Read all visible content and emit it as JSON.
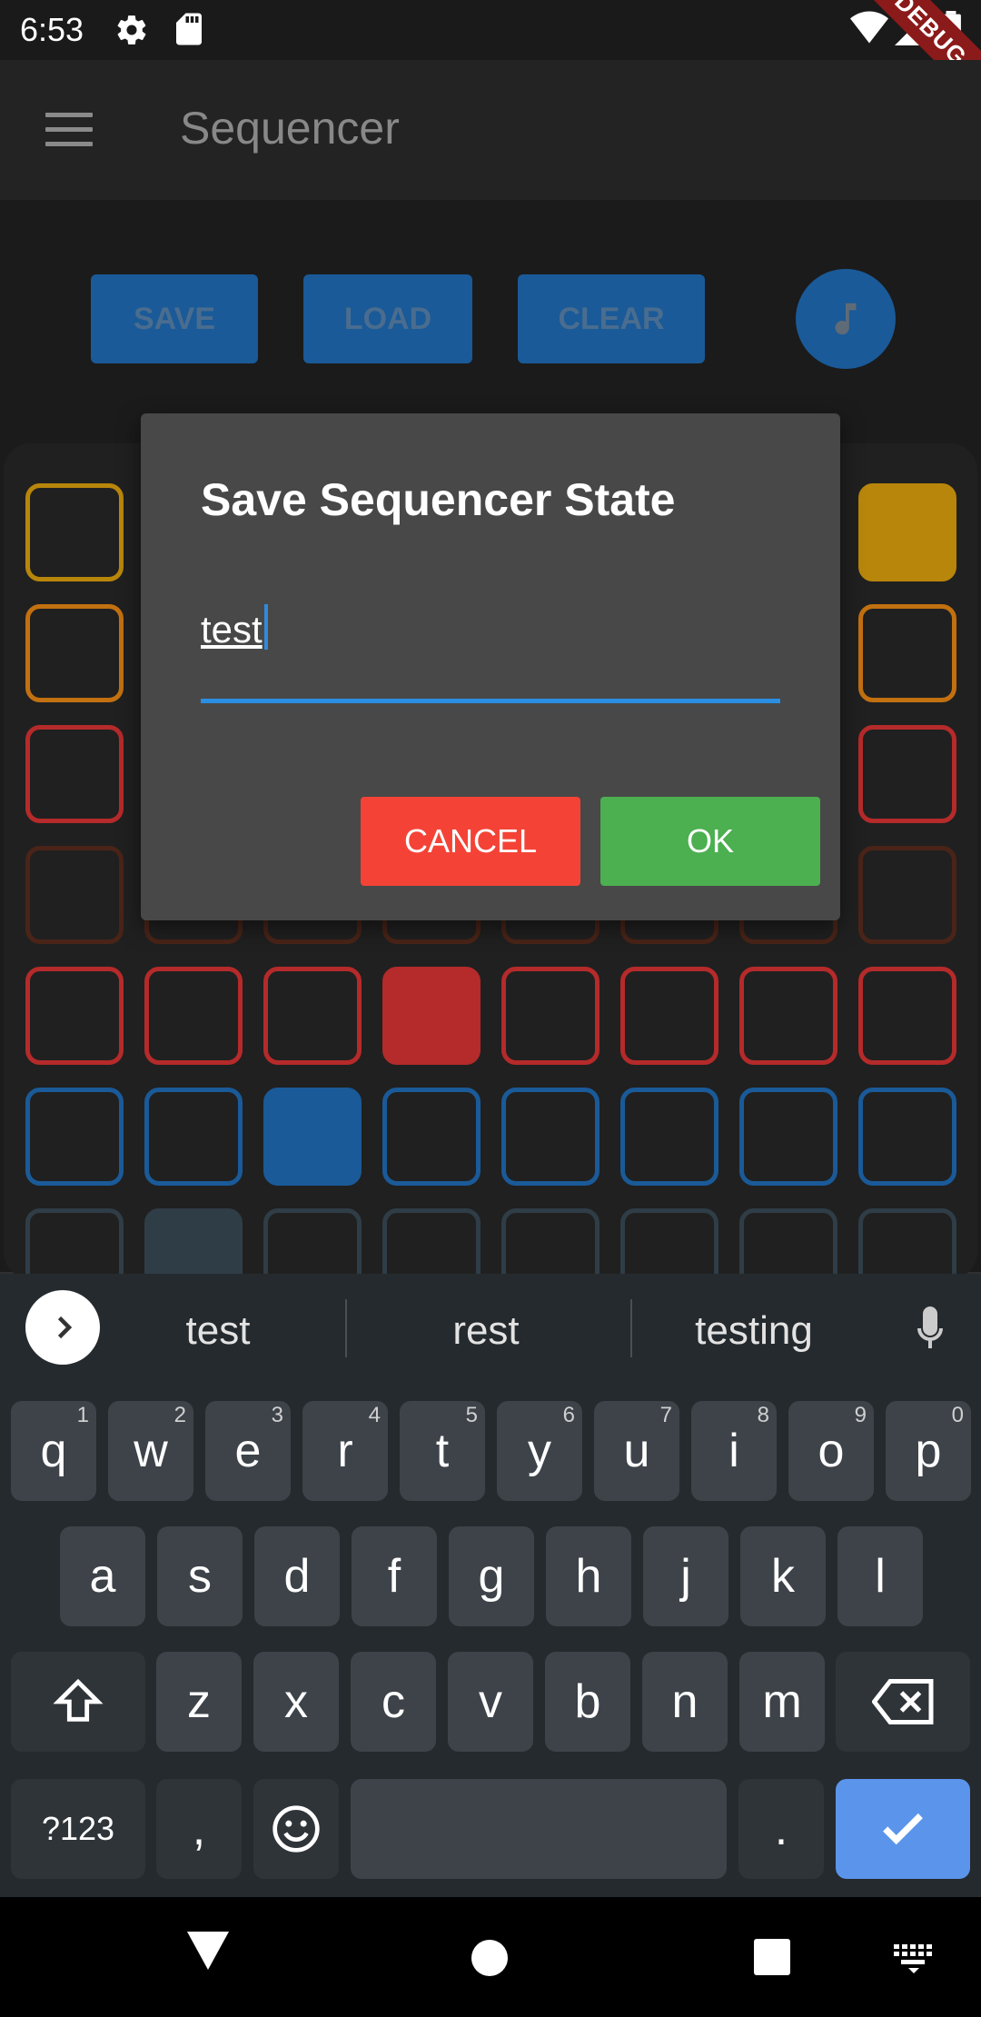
{
  "status_bar": {
    "time": "6:53",
    "debug_label": "DEBUG"
  },
  "app_bar": {
    "title": "Sequencer",
    "menu_icon": "menu-icon"
  },
  "toolbar": {
    "save_label": "SAVE",
    "load_label": "LOAD",
    "clear_label": "CLEAR",
    "fab_icon": "music-note-icon"
  },
  "grid": {
    "row_colors": [
      "#b8860b",
      "#c27010",
      "#b52a2a",
      "#4a2418",
      "#b52a2a",
      "#1a5a98",
      "#2f3d47"
    ],
    "active_cells": [
      [
        0,
        7
      ],
      [
        4,
        3
      ],
      [
        5,
        2
      ],
      [
        6,
        1
      ]
    ]
  },
  "dialog": {
    "title": "Save Sequencer State",
    "input_value": "test",
    "cancel_label": "CANCEL",
    "ok_label": "OK"
  },
  "keyboard": {
    "suggestions": [
      "test",
      "rest",
      "testing"
    ],
    "row1": [
      {
        "key": "q",
        "hint": "1"
      },
      {
        "key": "w",
        "hint": "2"
      },
      {
        "key": "e",
        "hint": "3"
      },
      {
        "key": "r",
        "hint": "4"
      },
      {
        "key": "t",
        "hint": "5"
      },
      {
        "key": "y",
        "hint": "6"
      },
      {
        "key": "u",
        "hint": "7"
      },
      {
        "key": "i",
        "hint": "8"
      },
      {
        "key": "o",
        "hint": "9"
      },
      {
        "key": "p",
        "hint": "0"
      }
    ],
    "row2": [
      "a",
      "s",
      "d",
      "f",
      "g",
      "h",
      "j",
      "k",
      "l"
    ],
    "row3": [
      "z",
      "x",
      "c",
      "v",
      "b",
      "n",
      "m"
    ],
    "symbols_label": "?123",
    "comma": ",",
    "period": "."
  },
  "colors": {
    "accent": "#2a8fe2",
    "cancel": "#f44336",
    "ok": "#4caf50",
    "toolbar_button": "#1a5a98",
    "enter_key": "#5b95eb"
  }
}
